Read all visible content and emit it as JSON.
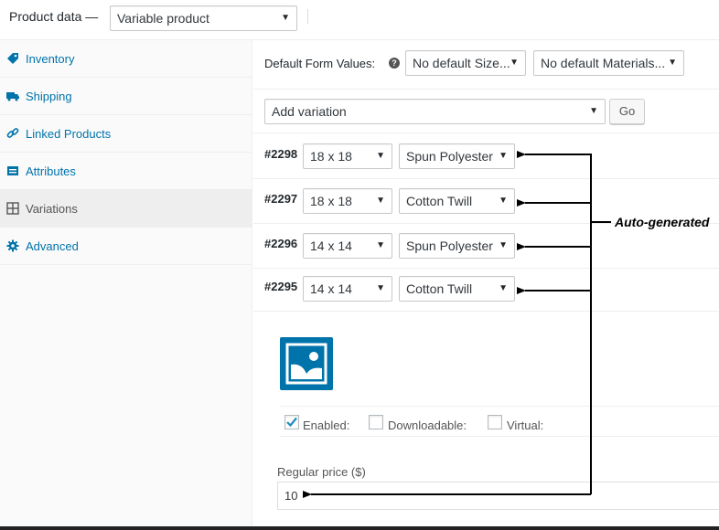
{
  "header": {
    "label": "Product data —",
    "product_type": "Variable product"
  },
  "sidebar": {
    "items": [
      {
        "label": "Inventory",
        "icon": "tag-icon"
      },
      {
        "label": "Shipping",
        "icon": "truck-icon"
      },
      {
        "label": "Linked Products",
        "icon": "link-icon"
      },
      {
        "label": "Attributes",
        "icon": "list-icon"
      },
      {
        "label": "Variations",
        "icon": "grid-icon",
        "active": true
      },
      {
        "label": "Advanced",
        "icon": "gear-icon"
      }
    ]
  },
  "defaults": {
    "label": "Default Form Values:",
    "size_select": "No default Size...",
    "materials_select": "No default Materials..."
  },
  "add_variation": {
    "select": "Add variation",
    "go_label": "Go"
  },
  "variations": [
    {
      "id": "#2298",
      "size": "18 x 18",
      "material": "Spun Polyester"
    },
    {
      "id": "#2297",
      "size": "18 x 18",
      "material": "Cotton Twill"
    },
    {
      "id": "#2296",
      "size": "14 x 14",
      "material": "Spun Polyester"
    },
    {
      "id": "#2295",
      "size": "14 x 14",
      "material": "Cotton Twill"
    }
  ],
  "variation_details": {
    "enabled_label": "Enabled:",
    "enabled_checked": true,
    "downloadable_label": "Downloadable:",
    "downloadable_checked": false,
    "virtual_label": "Virtual:",
    "virtual_checked": false,
    "regular_price_label": "Regular price ($)",
    "regular_price_value": "10"
  },
  "annotation": {
    "text": "Auto-generated"
  },
  "colors": {
    "link": "#0073aa",
    "accent": "#0073aa"
  }
}
